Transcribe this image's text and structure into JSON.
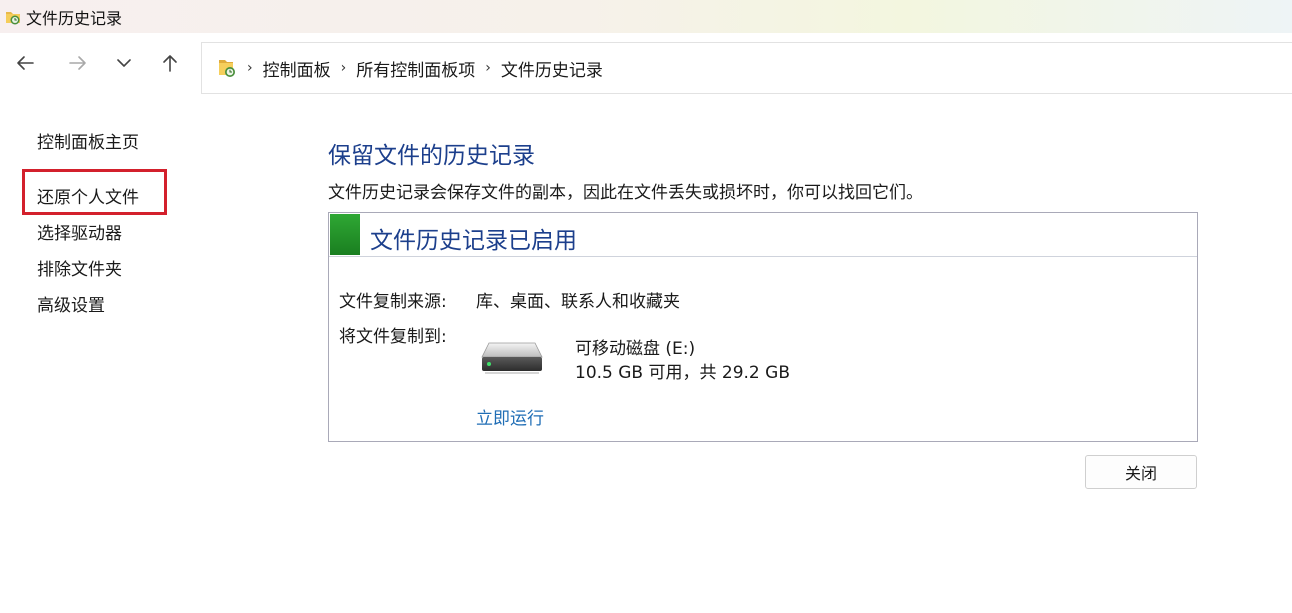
{
  "window": {
    "title": "文件历史记录",
    "icon": "file-history-icon"
  },
  "nav": {
    "back_icon": "arrow-left-icon",
    "forward_icon": "arrow-right-icon",
    "recent_icon": "chevron-down-icon",
    "up_icon": "arrow-up-icon"
  },
  "breadcrumb": {
    "icon": "file-history-folder-icon",
    "items": [
      "控制面板",
      "所有控制面板项",
      "文件历史记录"
    ]
  },
  "sidebar": {
    "items": [
      {
        "label": "控制面板主页"
      },
      {
        "label": "还原个人文件",
        "highlighted": true
      },
      {
        "label": "选择驱动器"
      },
      {
        "label": "排除文件夹"
      },
      {
        "label": "高级设置"
      }
    ],
    "highlight_color": "#d3202c"
  },
  "main": {
    "title": "保留文件的历史记录",
    "description": "文件历史记录会保存文件的副本，因此在文件丢失或损坏时，你可以找回它们。",
    "status": {
      "title": "文件历史记录已启用",
      "color": "#2fa834"
    },
    "source": {
      "label": "文件复制来源:",
      "value": "库、桌面、联系人和收藏夹"
    },
    "target": {
      "label": "将文件复制到:",
      "drive_icon": "removable-drive-icon",
      "drive_name": "可移动磁盘 (E:)",
      "drive_space": "10.5 GB 可用，共 29.2 GB"
    },
    "run_now": "立即运行",
    "accent_color": "#1c3f8c",
    "link_color": "#1f6db5"
  },
  "footer": {
    "close_label": "关闭"
  }
}
